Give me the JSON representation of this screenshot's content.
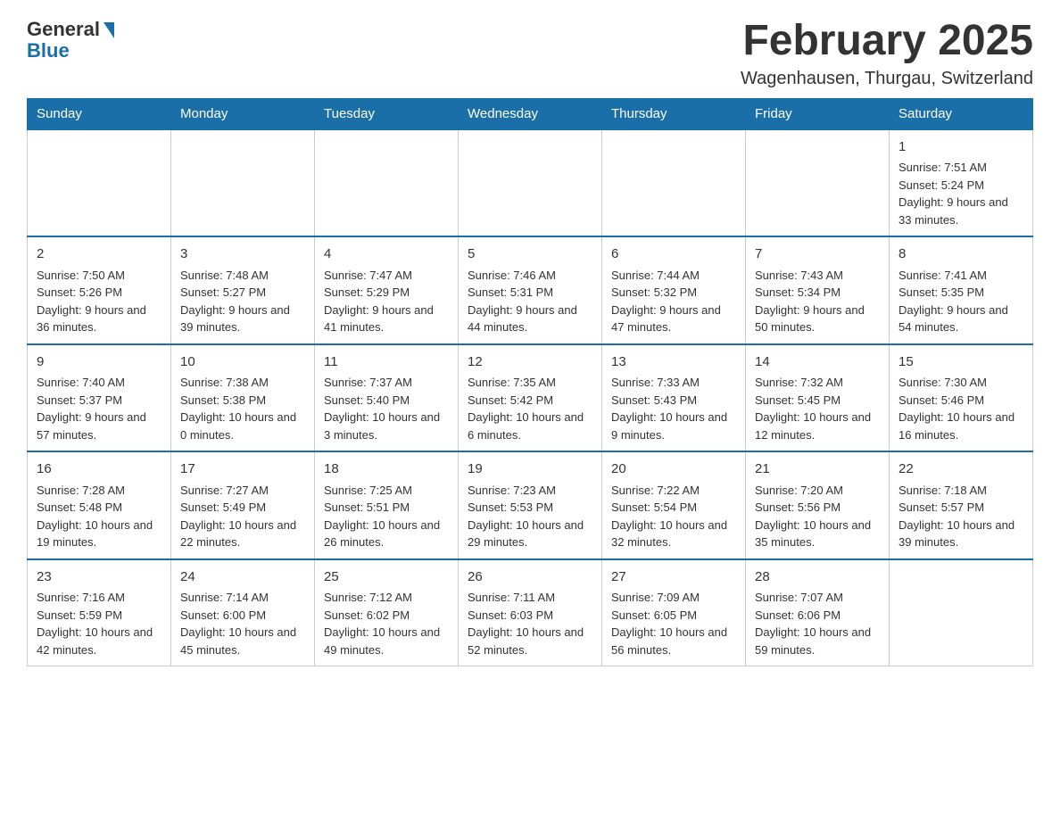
{
  "header": {
    "logo_general": "General",
    "logo_blue": "Blue",
    "title": "February 2025",
    "subtitle": "Wagenhausen, Thurgau, Switzerland"
  },
  "days_of_week": [
    "Sunday",
    "Monday",
    "Tuesday",
    "Wednesday",
    "Thursday",
    "Friday",
    "Saturday"
  ],
  "weeks": [
    [
      {
        "day": "",
        "info": ""
      },
      {
        "day": "",
        "info": ""
      },
      {
        "day": "",
        "info": ""
      },
      {
        "day": "",
        "info": ""
      },
      {
        "day": "",
        "info": ""
      },
      {
        "day": "",
        "info": ""
      },
      {
        "day": "1",
        "info": "Sunrise: 7:51 AM\nSunset: 5:24 PM\nDaylight: 9 hours and 33 minutes."
      }
    ],
    [
      {
        "day": "2",
        "info": "Sunrise: 7:50 AM\nSunset: 5:26 PM\nDaylight: 9 hours and 36 minutes."
      },
      {
        "day": "3",
        "info": "Sunrise: 7:48 AM\nSunset: 5:27 PM\nDaylight: 9 hours and 39 minutes."
      },
      {
        "day": "4",
        "info": "Sunrise: 7:47 AM\nSunset: 5:29 PM\nDaylight: 9 hours and 41 minutes."
      },
      {
        "day": "5",
        "info": "Sunrise: 7:46 AM\nSunset: 5:31 PM\nDaylight: 9 hours and 44 minutes."
      },
      {
        "day": "6",
        "info": "Sunrise: 7:44 AM\nSunset: 5:32 PM\nDaylight: 9 hours and 47 minutes."
      },
      {
        "day": "7",
        "info": "Sunrise: 7:43 AM\nSunset: 5:34 PM\nDaylight: 9 hours and 50 minutes."
      },
      {
        "day": "8",
        "info": "Sunrise: 7:41 AM\nSunset: 5:35 PM\nDaylight: 9 hours and 54 minutes."
      }
    ],
    [
      {
        "day": "9",
        "info": "Sunrise: 7:40 AM\nSunset: 5:37 PM\nDaylight: 9 hours and 57 minutes."
      },
      {
        "day": "10",
        "info": "Sunrise: 7:38 AM\nSunset: 5:38 PM\nDaylight: 10 hours and 0 minutes."
      },
      {
        "day": "11",
        "info": "Sunrise: 7:37 AM\nSunset: 5:40 PM\nDaylight: 10 hours and 3 minutes."
      },
      {
        "day": "12",
        "info": "Sunrise: 7:35 AM\nSunset: 5:42 PM\nDaylight: 10 hours and 6 minutes."
      },
      {
        "day": "13",
        "info": "Sunrise: 7:33 AM\nSunset: 5:43 PM\nDaylight: 10 hours and 9 minutes."
      },
      {
        "day": "14",
        "info": "Sunrise: 7:32 AM\nSunset: 5:45 PM\nDaylight: 10 hours and 12 minutes."
      },
      {
        "day": "15",
        "info": "Sunrise: 7:30 AM\nSunset: 5:46 PM\nDaylight: 10 hours and 16 minutes."
      }
    ],
    [
      {
        "day": "16",
        "info": "Sunrise: 7:28 AM\nSunset: 5:48 PM\nDaylight: 10 hours and 19 minutes."
      },
      {
        "day": "17",
        "info": "Sunrise: 7:27 AM\nSunset: 5:49 PM\nDaylight: 10 hours and 22 minutes."
      },
      {
        "day": "18",
        "info": "Sunrise: 7:25 AM\nSunset: 5:51 PM\nDaylight: 10 hours and 26 minutes."
      },
      {
        "day": "19",
        "info": "Sunrise: 7:23 AM\nSunset: 5:53 PM\nDaylight: 10 hours and 29 minutes."
      },
      {
        "day": "20",
        "info": "Sunrise: 7:22 AM\nSunset: 5:54 PM\nDaylight: 10 hours and 32 minutes."
      },
      {
        "day": "21",
        "info": "Sunrise: 7:20 AM\nSunset: 5:56 PM\nDaylight: 10 hours and 35 minutes."
      },
      {
        "day": "22",
        "info": "Sunrise: 7:18 AM\nSunset: 5:57 PM\nDaylight: 10 hours and 39 minutes."
      }
    ],
    [
      {
        "day": "23",
        "info": "Sunrise: 7:16 AM\nSunset: 5:59 PM\nDaylight: 10 hours and 42 minutes."
      },
      {
        "day": "24",
        "info": "Sunrise: 7:14 AM\nSunset: 6:00 PM\nDaylight: 10 hours and 45 minutes."
      },
      {
        "day": "25",
        "info": "Sunrise: 7:12 AM\nSunset: 6:02 PM\nDaylight: 10 hours and 49 minutes."
      },
      {
        "day": "26",
        "info": "Sunrise: 7:11 AM\nSunset: 6:03 PM\nDaylight: 10 hours and 52 minutes."
      },
      {
        "day": "27",
        "info": "Sunrise: 7:09 AM\nSunset: 6:05 PM\nDaylight: 10 hours and 56 minutes."
      },
      {
        "day": "28",
        "info": "Sunrise: 7:07 AM\nSunset: 6:06 PM\nDaylight: 10 hours and 59 minutes."
      },
      {
        "day": "",
        "info": ""
      }
    ]
  ]
}
